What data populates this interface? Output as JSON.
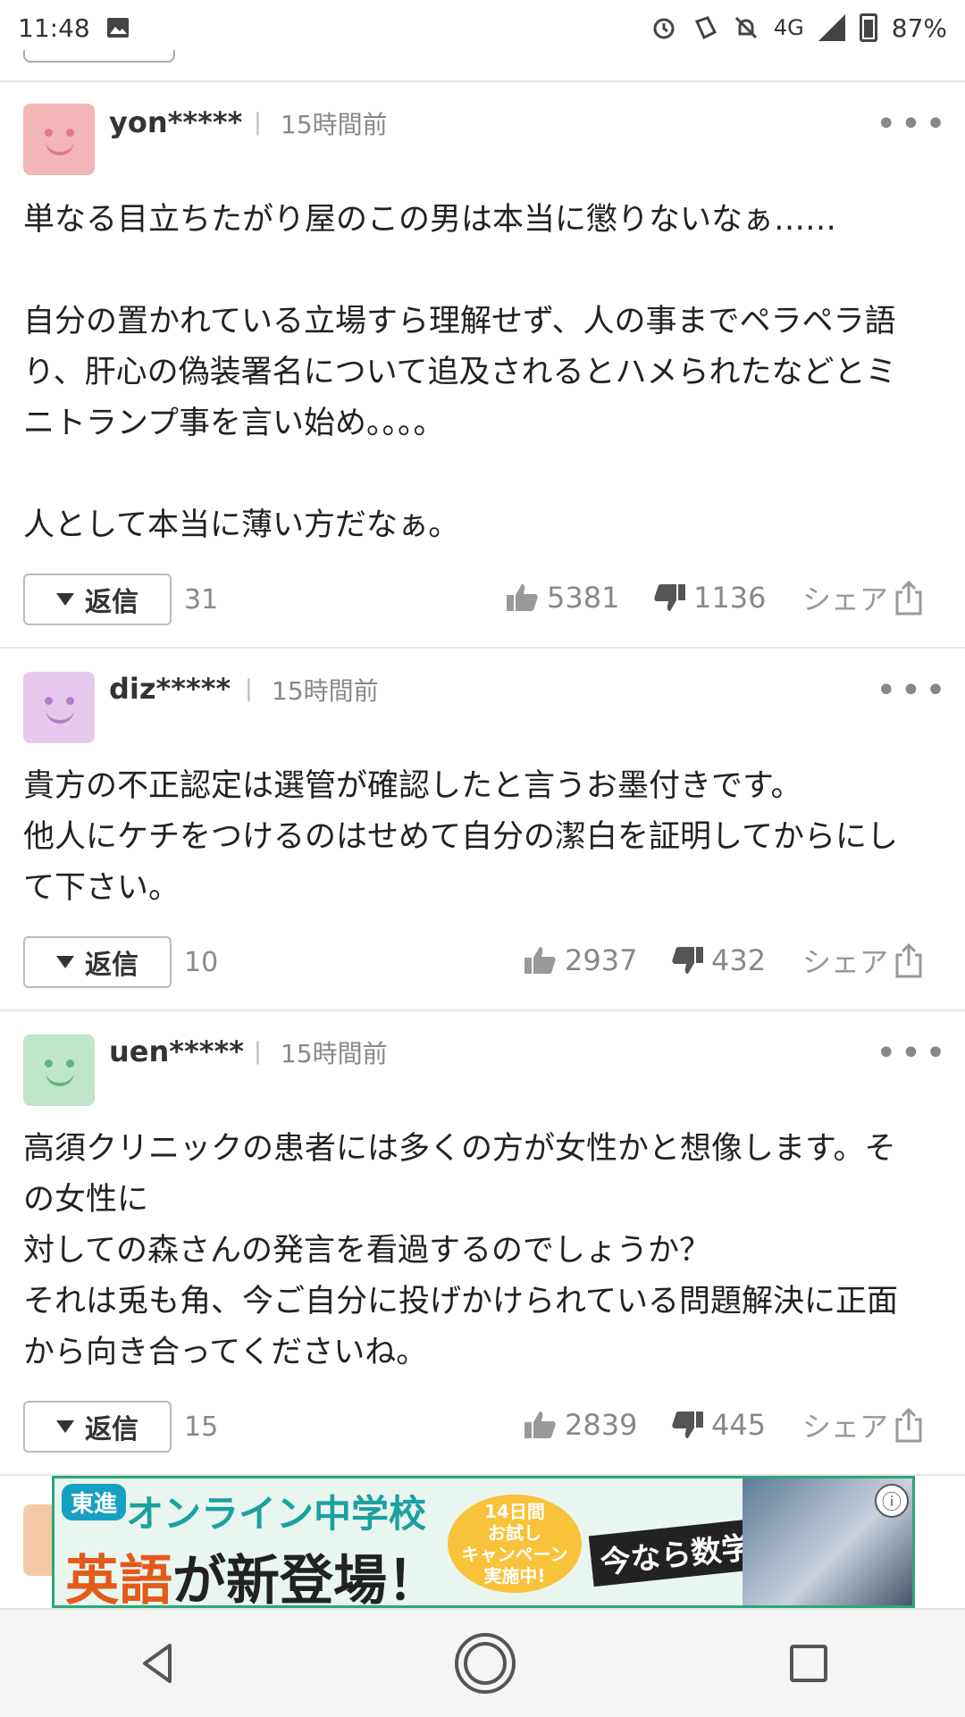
{
  "status_bar": {
    "time": "11:48",
    "network": "4G",
    "battery": "87%"
  },
  "comments": [
    {
      "user": "yon*****",
      "time": "15時間前",
      "avatar_color": "#f2b5b8",
      "avatar_feature": "#e07a80",
      "text": "単なる目立ちたがり屋のこの男は本当に懲りないなぁ……\n\n自分の置かれている立場すら理解せず、人の事までペラペラ語り、肝心の偽装署名について追及されるとハメられたなどとミニトランプ事を言い始め。。。。\n\n人として本当に薄い方だなぁ。",
      "reply_label": "返信",
      "reply_count": "31",
      "likes": "5381",
      "dislikes": "1136",
      "share_label": "シェア"
    },
    {
      "user": "diz*****",
      "time": "15時間前",
      "avatar_color": "#e6c8ee",
      "avatar_feature": "#b57ec9",
      "text": "貴方の不正認定は選管が確認したと言うお墨付きです。\n他人にケチをつけるのはせめて自分の潔白を証明してからにして下さい。",
      "reply_label": "返信",
      "reply_count": "10",
      "likes": "2937",
      "dislikes": "432",
      "share_label": "シェア"
    },
    {
      "user": "uen*****",
      "time": "15時間前",
      "avatar_color": "#bfe6c8",
      "avatar_feature": "#62b57a",
      "text": "高須クリニックの患者には多くの方が女性かと想像します。その女性に\n対しての森さんの発言を看過するのでしょうか？\nそれは兎も角、今ご自分に投げかけられている問題解決に正面から向き合ってくださいね。",
      "reply_label": "返信",
      "reply_count": "15",
      "likes": "2839",
      "dislikes": "445",
      "share_label": "シェア"
    }
  ],
  "ad": {
    "badge": "東進",
    "line1": "オンライン中学校",
    "line2_highlight": "英語",
    "line2_rest": "が新登場！",
    "bubble": "14日間\nお試し\nキャンペーン\n実施中!",
    "promo": "今なら数学無料!",
    "info_icon": "ⓘ"
  }
}
